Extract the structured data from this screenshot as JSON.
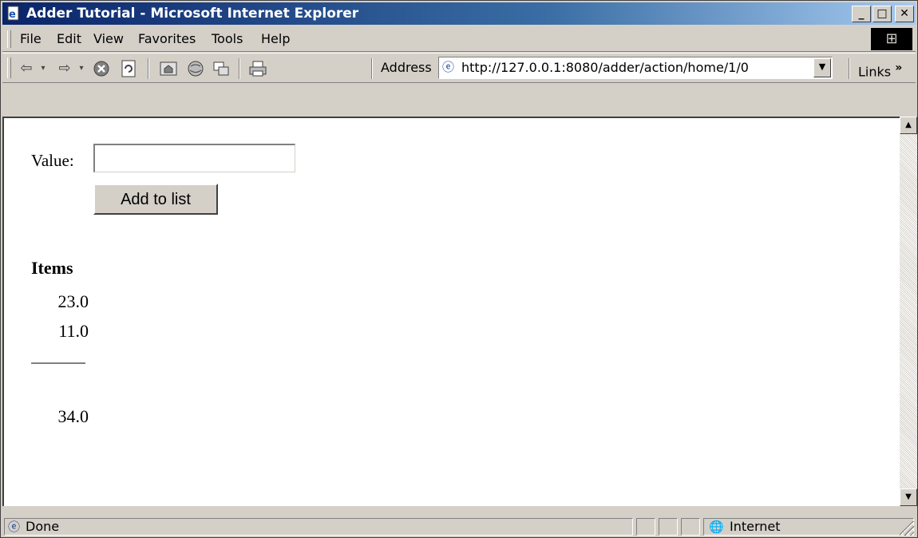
{
  "window": {
    "title": "Adder Tutorial - Microsoft Internet Explorer",
    "minimize": "_",
    "maximize": "□",
    "close": "✕"
  },
  "menu": [
    "File",
    "Edit",
    "View",
    "Favorites",
    "Tools",
    "Help"
  ],
  "toolbar": {
    "address_label": "Address",
    "url": "http://127.0.0.1:8080/adder/action/home/1/0",
    "links_label": "Links",
    "links_chevron": "»"
  },
  "form": {
    "value_label": "Value:",
    "value_input": "",
    "add_button": "Add to list"
  },
  "items": {
    "heading": "Items",
    "values": [
      "23.0",
      "11.0"
    ],
    "total": "34.0"
  },
  "status": {
    "text": "Done",
    "zone": "Internet"
  },
  "icons": {
    "app": "ie-page-icon",
    "back": "back-arrow-icon",
    "forward": "forward-arrow-icon",
    "stop": "stop-icon",
    "refresh": "refresh-icon",
    "home": "home-icon",
    "search": "search-icon",
    "favorites": "favorites-icon",
    "history": "history-icon",
    "print": "print-icon",
    "zone": "globe-icon"
  }
}
